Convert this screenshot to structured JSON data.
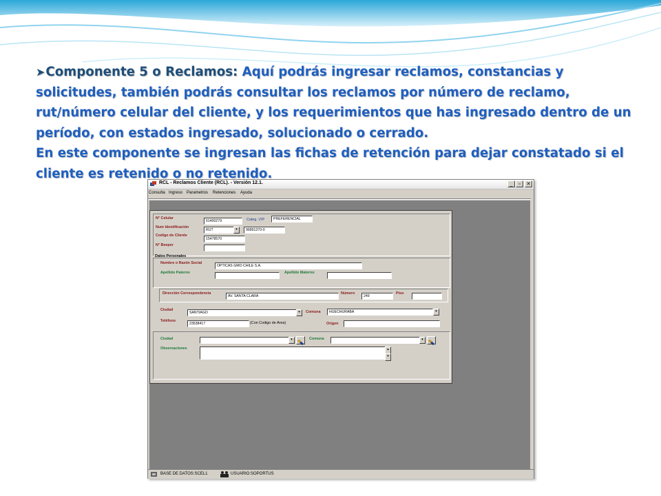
{
  "slide": {
    "heading": "Componente 5 o Reclamos:",
    "text1": " Aquí podrás ingresar reclamos, constancias y solicitudes, también podrás consultar los reclamos por número de reclamo, rut/número celular del cliente, y  los requerimientos que has ingresado dentro de un período, con estados ingresado, solucionado o cerrado.",
    "text2": "En este componente se ingresan las fichas de retención para dejar constatado si el cliente es retenido o no retenido."
  },
  "window": {
    "title": "RCL - Reclamos Cliente (RCL).  - Versión 12.1.",
    "menu": [
      "Consulta",
      "Ingreso",
      "Parametros",
      "Retenciones",
      "Ayuda"
    ],
    "buttons": {
      "minimize": "_",
      "restore": "▫",
      "close": "✕"
    }
  },
  "form": {
    "celular": {
      "label": "N° Celular",
      "value": "61400279"
    },
    "categ": {
      "label": "Categ. VIP",
      "value": "PREFERENCIAL"
    },
    "identificacion": {
      "label": "Num Identificación",
      "type": "RUT",
      "value": "96891370-0"
    },
    "codigo": {
      "label": "Codigo de Cliente",
      "value": "15478570"
    },
    "beeper": {
      "label": "N° Beeper",
      "value": ""
    },
    "datos_personales": "Datos Personales",
    "nombre": {
      "label": "Nombre o Razón Social",
      "value": "OPTICAS GMO CHILE S.A."
    },
    "apellido_paterno": {
      "label": "Apellido Paterno",
      "value": ""
    },
    "apellido_materno": {
      "label": "Apellido Materno",
      "value": ""
    },
    "direccion": {
      "label": "Dirección Correspondencia",
      "value": "AV. SANTA CLARA"
    },
    "numero": {
      "label": "Número",
      "value": "249"
    },
    "piso": {
      "label": "Piso",
      "value": ""
    },
    "ciudad": {
      "label": "Ciudad",
      "value": "SANTIAGO"
    },
    "comuna": {
      "label": "Comuna",
      "value": "HUECHURABA"
    },
    "telefono": {
      "label": "Teléfono",
      "value": "23538417",
      "note": "(Con Codigo de Area)"
    },
    "origen": {
      "label": "Origen",
      "value": ""
    },
    "ciudad2": {
      "label": "Ciudad",
      "value": ""
    },
    "comuna2": {
      "label": "Comuna",
      "value": ""
    },
    "observaciones": {
      "label": "Observaciones",
      "value": ""
    }
  },
  "status": {
    "db": "BASE DE DATOS:SCEL1",
    "user": "USUARIO:SOPORTUS"
  },
  "colors": {
    "heading": "#1f4e79",
    "body_text": "#1f5fbf",
    "field_label": "#8b1a1a"
  }
}
